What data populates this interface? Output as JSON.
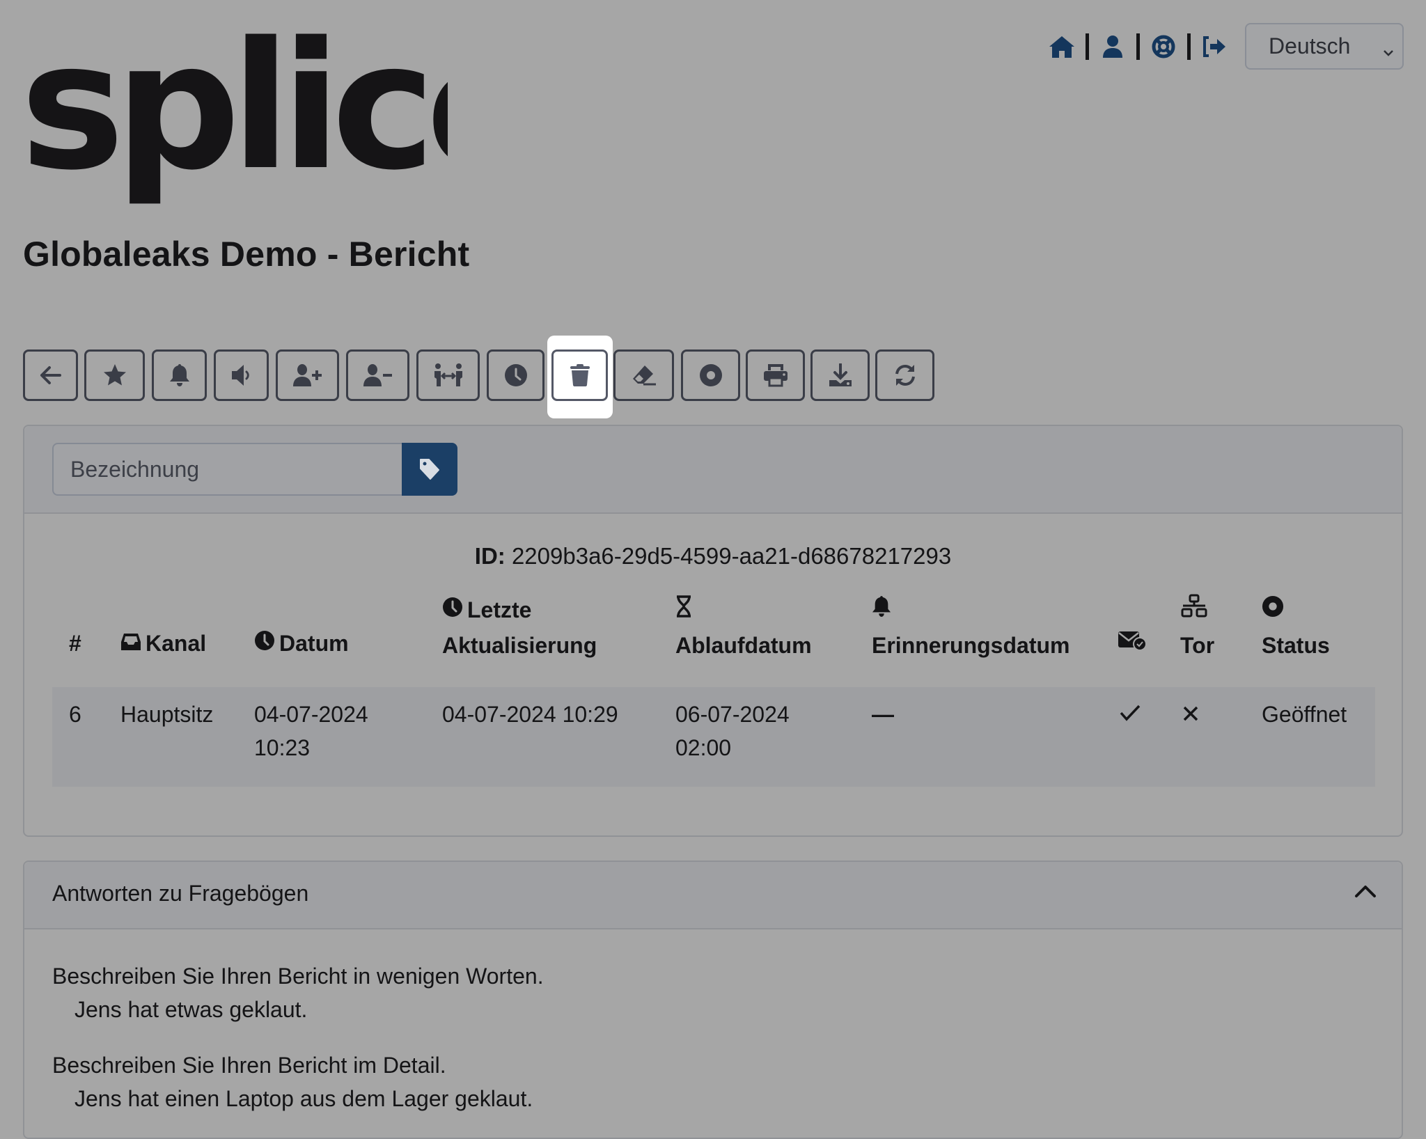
{
  "brand": {
    "logo_text": "splice"
  },
  "page": {
    "title": "Globaleaks Demo - Bericht"
  },
  "topnav": {
    "items": [
      {
        "name": "home",
        "icon": "home-icon"
      },
      {
        "name": "user",
        "icon": "user-icon"
      },
      {
        "name": "support",
        "icon": "life-ring-icon"
      },
      {
        "name": "logout",
        "icon": "logout-icon"
      }
    ],
    "icon_color": "#14365c"
  },
  "language": {
    "selected": "Deutsch"
  },
  "toolbar": {
    "buttons": [
      {
        "name": "back",
        "icon": "arrow-left-icon"
      },
      {
        "name": "star",
        "icon": "star-icon"
      },
      {
        "name": "reminder",
        "icon": "bell-icon"
      },
      {
        "name": "notify",
        "icon": "volume-icon"
      },
      {
        "name": "grant-access",
        "icon": "user-plus-icon"
      },
      {
        "name": "revoke-access",
        "icon": "user-minus-icon"
      },
      {
        "name": "transfer",
        "icon": "people-arrows-icon"
      },
      {
        "name": "postpone",
        "icon": "clock-icon"
      },
      {
        "name": "delete",
        "icon": "trash-icon",
        "highlighted": true
      },
      {
        "name": "erase",
        "icon": "eraser-icon"
      },
      {
        "name": "status",
        "icon": "circle-dot-icon"
      },
      {
        "name": "print",
        "icon": "print-icon"
      },
      {
        "name": "download",
        "icon": "download-icon"
      },
      {
        "name": "reload",
        "icon": "refresh-icon"
      }
    ]
  },
  "label_form": {
    "placeholder": "Bezeichnung",
    "button_icon": "tag-icon",
    "button_color": "#1b3f66"
  },
  "report": {
    "id_label": "ID:",
    "id_value": "2209b3a6-29d5-4599-aa21-d68678217293",
    "columns": {
      "number": "#",
      "channel": "Kanal",
      "date": "Datum",
      "last_update_1": "Letzte",
      "last_update_2": "Aktualisierung",
      "expiry": "Ablaufdatum",
      "reminder": "Erinnerungsdatum",
      "tor": "Tor",
      "status": "Status"
    },
    "row": {
      "number": "6",
      "channel": "Hauptsitz",
      "date_1": "04-07-2024",
      "date_2": "10:23",
      "last_update": "04-07-2024 10:29",
      "expiry_1": "06-07-2024",
      "expiry_2": "02:00",
      "reminder": "—",
      "notification": "✓",
      "tor": "✕",
      "status": "Geöffnet"
    }
  },
  "questionnaire": {
    "title": "Antworten zu Fragebögen",
    "expanded": true,
    "items": [
      {
        "question": "Beschreiben Sie Ihren Bericht in wenigen Worten.",
        "answer": "Jens hat etwas geklaut."
      },
      {
        "question": "Beschreiben Sie Ihren Bericht im Detail.",
        "answer": "Jens hat einen Laptop aus dem Lager geklaut."
      }
    ]
  }
}
